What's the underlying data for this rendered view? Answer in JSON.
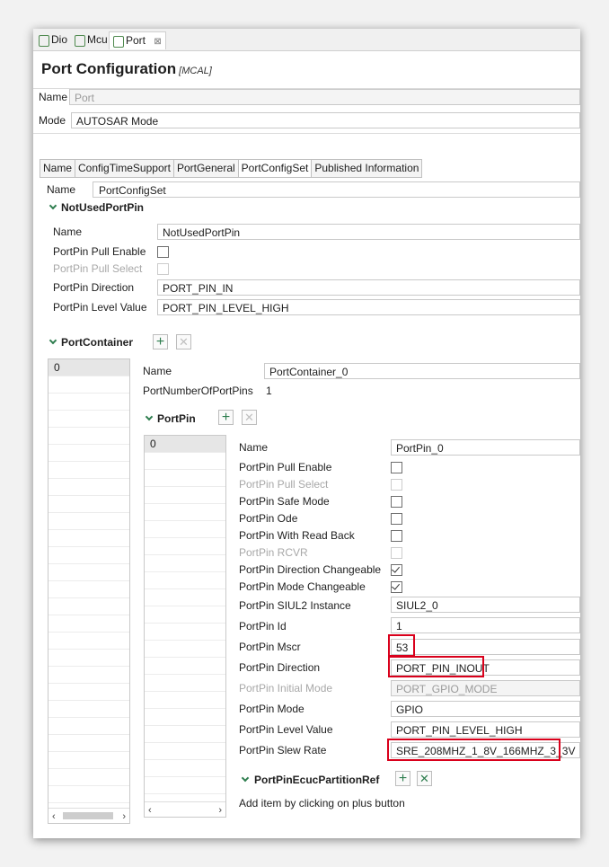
{
  "tabs": [
    {
      "label": "Dio"
    },
    {
      "label": "Mcu"
    },
    {
      "label": "Port",
      "close": "⊠"
    }
  ],
  "page_title": "Port Configuration",
  "page_subtitle": "[MCAL]",
  "header": {
    "name_label": "Name",
    "name_value": "Port",
    "mode_label": "Mode",
    "mode_value": "AUTOSAR Mode"
  },
  "prop_tabs": [
    "Name",
    "ConfigTimeSupport",
    "PortGeneral",
    "PortConfigSet",
    "Published Information"
  ],
  "config_set": {
    "name_label": "Name",
    "name_value": "PortConfigSet"
  },
  "not_used": {
    "title": "NotUsedPortPin",
    "rows": {
      "name_label": "Name",
      "name_value": "NotUsedPortPin",
      "pull_enable_label": "PortPin Pull Enable",
      "pull_select_label": "PortPin Pull Select",
      "direction_label": "PortPin Direction",
      "direction_value": "PORT_PIN_IN",
      "level_label": "PortPin Level Value",
      "level_value": "PORT_PIN_LEVEL_HIGH"
    }
  },
  "container": {
    "title": "PortContainer",
    "list_item": "0",
    "name_label": "Name",
    "name_value": "PortContainer_0",
    "num_pins_label": "PortNumberOfPortPins",
    "num_pins_value": "1"
  },
  "pin": {
    "title": "PortPin",
    "list_item": "0",
    "name_label": "Name",
    "name_value": "PortPin_0",
    "pull_enable_label": "PortPin Pull Enable",
    "pull_select_label": "PortPin Pull Select",
    "safe_mode_label": "PortPin Safe Mode",
    "ode_label": "PortPin Ode",
    "read_back_label": "PortPin With Read Back",
    "rcvr_label": "PortPin RCVR",
    "dir_changeable_label": "PortPin Direction Changeable",
    "mode_changeable_label": "PortPin Mode Changeable",
    "siul2_label": "PortPin SIUL2 Instance",
    "siul2_value": "SIUL2_0",
    "id_label": "PortPin Id",
    "id_value": "1",
    "mscr_label": "PortPin Mscr",
    "mscr_value": "53",
    "direction_label": "PortPin Direction",
    "direction_value": "PORT_PIN_INOUT",
    "initial_mode_label": "PortPin Initial Mode",
    "initial_mode_value": "PORT_GPIO_MODE",
    "mode_label": "PortPin Mode",
    "mode_value": "GPIO",
    "level_label": "PortPin Level Value",
    "level_value": "PORT_PIN_LEVEL_HIGH",
    "slew_label": "PortPin Slew Rate",
    "slew_value": "SRE_208MHZ_1_8V_166MHZ_3_3V"
  },
  "ecuc": {
    "title": "PortPinEcucPartitionRef",
    "hint": "Add item by clicking on plus button"
  },
  "icons": {
    "plus": "+",
    "cross": "✕"
  },
  "colors": {
    "highlight": "#d9001b",
    "accent": "#2e7d4e"
  }
}
